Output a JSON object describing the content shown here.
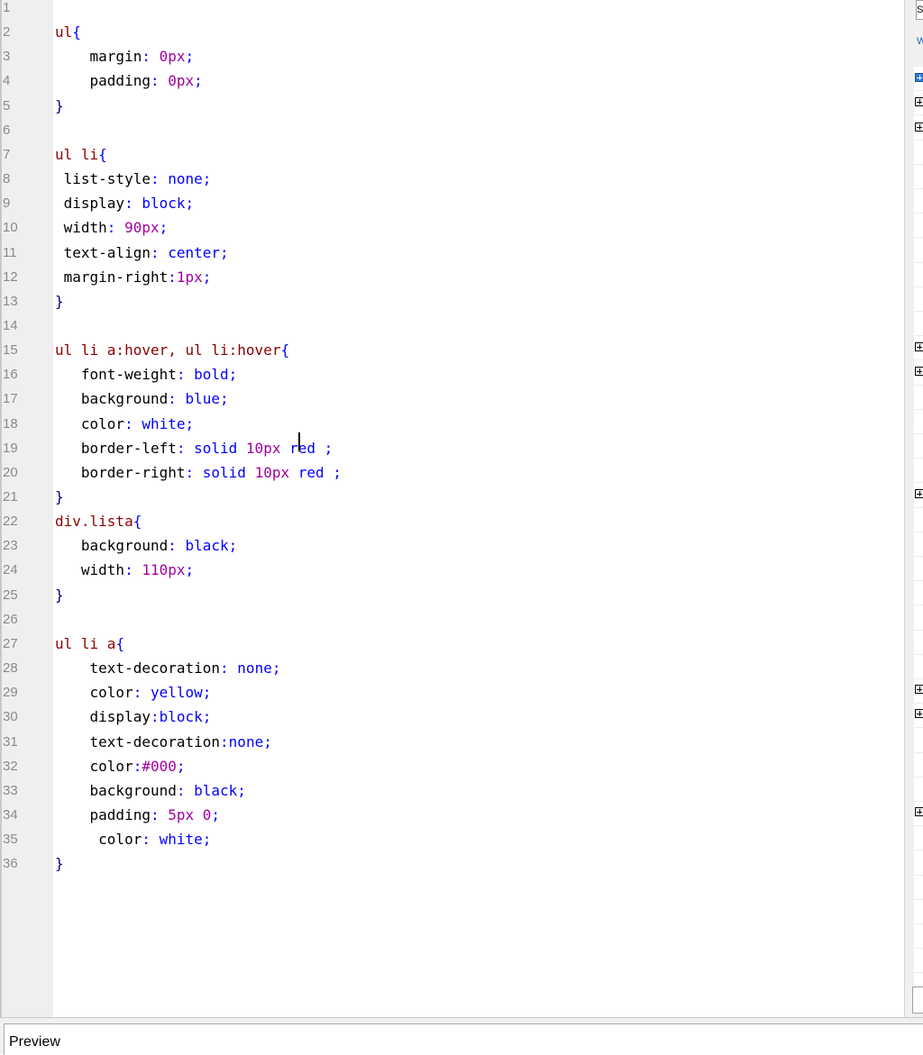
{
  "editor": {
    "lines": [
      {
        "n": "1",
        "tokens": []
      },
      {
        "n": "2",
        "tokens": [
          [
            "sel",
            "ul"
          ],
          [
            "punc",
            "{"
          ]
        ]
      },
      {
        "n": "3",
        "tokens": [
          [
            "prop",
            "    margin"
          ],
          [
            "punc",
            ": "
          ],
          [
            "num",
            "0px"
          ],
          [
            "punc",
            ";"
          ]
        ]
      },
      {
        "n": "4",
        "tokens": [
          [
            "prop",
            "    padding"
          ],
          [
            "punc",
            ": "
          ],
          [
            "num",
            "0px"
          ],
          [
            "punc",
            ";"
          ]
        ]
      },
      {
        "n": "5",
        "tokens": [
          [
            "brace",
            "}"
          ]
        ]
      },
      {
        "n": "6",
        "tokens": []
      },
      {
        "n": "7",
        "tokens": [
          [
            "sel",
            "ul li"
          ],
          [
            "punc",
            "{"
          ]
        ]
      },
      {
        "n": "8",
        "tokens": [
          [
            "prop",
            " list-style"
          ],
          [
            "punc",
            ": "
          ],
          [
            "val",
            "none"
          ],
          [
            "punc",
            ";"
          ]
        ]
      },
      {
        "n": "9",
        "tokens": [
          [
            "prop",
            " display"
          ],
          [
            "punc",
            ": "
          ],
          [
            "val",
            "block"
          ],
          [
            "punc",
            ";"
          ]
        ]
      },
      {
        "n": "10",
        "tokens": [
          [
            "prop",
            " width"
          ],
          [
            "punc",
            ": "
          ],
          [
            "num",
            "90px"
          ],
          [
            "punc",
            ";"
          ]
        ]
      },
      {
        "n": "11",
        "tokens": [
          [
            "prop",
            " text-align"
          ],
          [
            "punc",
            ": "
          ],
          [
            "val",
            "center"
          ],
          [
            "punc",
            ";"
          ]
        ]
      },
      {
        "n": "12",
        "tokens": [
          [
            "prop",
            " margin-right"
          ],
          [
            "punc",
            ":"
          ],
          [
            "num",
            "1px"
          ],
          [
            "punc",
            ";"
          ]
        ]
      },
      {
        "n": "13",
        "tokens": [
          [
            "brace",
            "}"
          ]
        ]
      },
      {
        "n": "14",
        "tokens": []
      },
      {
        "n": "15",
        "tokens": [
          [
            "sel",
            "ul li a:hover, ul li:hover"
          ],
          [
            "punc",
            "{"
          ]
        ]
      },
      {
        "n": "16",
        "tokens": [
          [
            "prop",
            "   font-weight"
          ],
          [
            "punc",
            ": "
          ],
          [
            "val",
            "bold"
          ],
          [
            "punc",
            ";"
          ]
        ]
      },
      {
        "n": "17",
        "tokens": [
          [
            "prop",
            "   background"
          ],
          [
            "punc",
            ": "
          ],
          [
            "val",
            "blue"
          ],
          [
            "punc",
            ";"
          ]
        ]
      },
      {
        "n": "18",
        "tokens": [
          [
            "prop",
            "   color"
          ],
          [
            "punc",
            ": "
          ],
          [
            "val",
            "white"
          ],
          [
            "punc",
            ";"
          ]
        ]
      },
      {
        "n": "19",
        "tokens": [
          [
            "prop",
            "   border-left"
          ],
          [
            "punc",
            ": "
          ],
          [
            "val",
            "solid "
          ],
          [
            "num",
            "10px"
          ],
          [
            "val",
            " red "
          ],
          [
            "punc",
            ";"
          ]
        ]
      },
      {
        "n": "20",
        "tokens": [
          [
            "prop",
            "   border-right"
          ],
          [
            "punc",
            ": "
          ],
          [
            "val",
            "solid "
          ],
          [
            "num",
            "10px"
          ],
          [
            "val",
            " red "
          ],
          [
            "punc",
            ";"
          ]
        ]
      },
      {
        "n": "21",
        "tokens": [
          [
            "brace",
            "}"
          ]
        ]
      },
      {
        "n": "22",
        "tokens": [
          [
            "sel",
            "div.lista"
          ],
          [
            "punc",
            "{"
          ]
        ]
      },
      {
        "n": "23",
        "tokens": [
          [
            "prop",
            "   background"
          ],
          [
            "punc",
            ": "
          ],
          [
            "val",
            "black"
          ],
          [
            "punc",
            ";"
          ]
        ]
      },
      {
        "n": "24",
        "tokens": [
          [
            "prop",
            "   width"
          ],
          [
            "punc",
            ": "
          ],
          [
            "num",
            "110px"
          ],
          [
            "punc",
            ";"
          ]
        ]
      },
      {
        "n": "25",
        "tokens": [
          [
            "brace",
            "}"
          ]
        ]
      },
      {
        "n": "26",
        "tokens": []
      },
      {
        "n": "27",
        "tokens": [
          [
            "sel",
            "ul li a"
          ],
          [
            "punc",
            "{"
          ]
        ]
      },
      {
        "n": "28",
        "tokens": [
          [
            "prop",
            "    text-decoration"
          ],
          [
            "punc",
            ": "
          ],
          [
            "val",
            "none"
          ],
          [
            "punc",
            ";"
          ]
        ]
      },
      {
        "n": "29",
        "tokens": [
          [
            "prop",
            "    color"
          ],
          [
            "punc",
            ": "
          ],
          [
            "val",
            "yellow"
          ],
          [
            "punc",
            ";"
          ]
        ]
      },
      {
        "n": "30",
        "tokens": [
          [
            "prop",
            "    display"
          ],
          [
            "punc",
            ":"
          ],
          [
            "val",
            "block"
          ],
          [
            "punc",
            ";"
          ]
        ]
      },
      {
        "n": "31",
        "tokens": [
          [
            "prop",
            "    text-decoration"
          ],
          [
            "punc",
            ":"
          ],
          [
            "val",
            "none"
          ],
          [
            "punc",
            ";"
          ]
        ]
      },
      {
        "n": "32",
        "tokens": [
          [
            "prop",
            "    color"
          ],
          [
            "punc",
            ":"
          ],
          [
            "num",
            "#000"
          ],
          [
            "punc",
            ";"
          ]
        ]
      },
      {
        "n": "33",
        "tokens": [
          [
            "prop",
            "    background"
          ],
          [
            "punc",
            ": "
          ],
          [
            "val",
            "black"
          ],
          [
            "punc",
            ";"
          ]
        ]
      },
      {
        "n": "34",
        "tokens": [
          [
            "prop",
            "    padding"
          ],
          [
            "punc",
            ": "
          ],
          [
            "num",
            "5px 0"
          ],
          [
            "punc",
            ";"
          ]
        ]
      },
      {
        "n": "35",
        "tokens": [
          [
            "prop",
            "     color"
          ],
          [
            "punc",
            ": "
          ],
          [
            "val",
            "white"
          ],
          [
            "punc",
            ";"
          ]
        ]
      },
      {
        "n": "36",
        "tokens": [
          [
            "brace",
            "}"
          ]
        ]
      }
    ]
  },
  "side_panel": {
    "top_label": "S",
    "tab_label": "W",
    "expander_icon": "plus-box-icon"
  },
  "preview": {
    "label": "Preview"
  },
  "colors": {
    "selector": "#8b0000",
    "value": "#0000ff",
    "number": "#a000a0",
    "selection_accent": "#2f7ad6"
  }
}
